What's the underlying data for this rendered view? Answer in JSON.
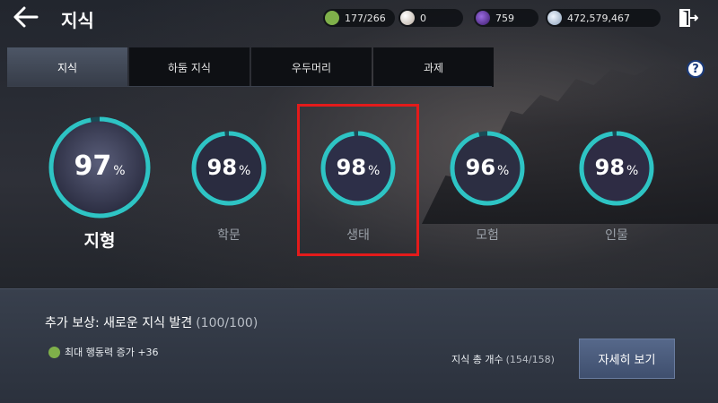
{
  "header": {
    "title": "지식",
    "back_icon": "arrow-left-icon",
    "exit_icon": "exit-door-icon",
    "resources": [
      {
        "icon": "action-point-icon",
        "value": "177/266",
        "color": "#7fb04a"
      },
      {
        "icon": "pearl-icon",
        "value": "0",
        "color": "#d8d0c8"
      },
      {
        "icon": "dark-gem-icon",
        "value": "759",
        "color": "#6a3fa8"
      },
      {
        "icon": "silver-coin-icon",
        "value": "472,579,467",
        "color": "#b8c8d8"
      }
    ]
  },
  "tabs": [
    {
      "label": "지식",
      "active": true
    },
    {
      "label": "하둠 지식",
      "active": false
    },
    {
      "label": "우두머리",
      "active": false
    },
    {
      "label": "과제",
      "active": false
    }
  ],
  "help_label": "?",
  "categories": [
    {
      "name": "지형",
      "percent": 97,
      "unit": "%",
      "selected": true
    },
    {
      "name": "학문",
      "percent": 98,
      "unit": "%",
      "selected": false
    },
    {
      "name": "생태",
      "percent": 98,
      "unit": "%",
      "selected": false
    },
    {
      "name": "모험",
      "percent": 96,
      "unit": "%",
      "selected": false
    },
    {
      "name": "인물",
      "percent": 98,
      "unit": "%",
      "selected": false
    }
  ],
  "reward": {
    "title": "추가 보상: 새로운 지식 발견",
    "count": "(100/100)",
    "item_icon": "action-point-icon",
    "item_text": "최대 행동력 증가 +36"
  },
  "total": {
    "label": "지식 총 개수",
    "count": "(154/158)"
  },
  "detail_button": "자세히 보기",
  "colors": {
    "ring_progress": "#2ec4c4",
    "ring_track": "#1a4a55",
    "highlight": "#e31b1b"
  }
}
